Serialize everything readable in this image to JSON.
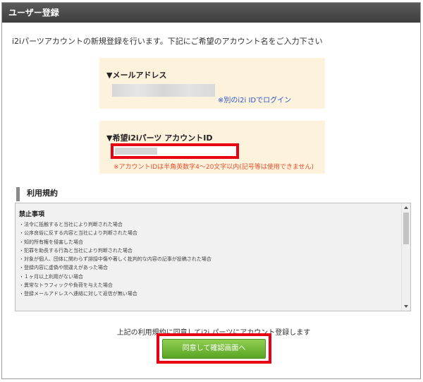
{
  "header": {
    "title": "ユーザー登録"
  },
  "intro": "i2iパーツアカウントの新規登録を行います。下記にご希望のアカウント名をご入力下さい",
  "email_box": {
    "label": "▼メールアドレス",
    "login_link": "※別のi2i IDでログイン"
  },
  "account_box": {
    "label": "▼希望i2iパーツ アカウントID",
    "note": "※アカウントIDは半角英数字4〜20文字以内(記号等は使用できません)"
  },
  "terms": {
    "title": "利用規約",
    "heading": "禁止事項",
    "items": [
      "・法令に抵触すると当社により判断された場合",
      "・公序良俗に反する内容と当社により判断された場合",
      "・知的所有権を侵害した場合",
      "・犯罪を助長する行為と当社により判断された場合",
      "・対象が個人、団体に関わらず誹謗中傷や著しく批判的な内容の記事が投稿された場合",
      "・登録内容に虚偽や間違えがあった場合",
      "・１ヶ月以上利用がない場合",
      "・異常なトラフィックや負荷を与えた場合",
      "・登録メールアドレスへ連絡に対して返信が無い場合"
    ]
  },
  "agree_text": "上記の利用規約に同意してi2i パーツにアカウント登録します",
  "submit_label": "同意して確認画面へ",
  "colors": {
    "header_bg": "#3e3e3e",
    "box_bg": "#fdf3dd",
    "highlight": "#e60012",
    "link": "#2b54c9",
    "note": "#e8502a",
    "button": "#6db32f"
  }
}
